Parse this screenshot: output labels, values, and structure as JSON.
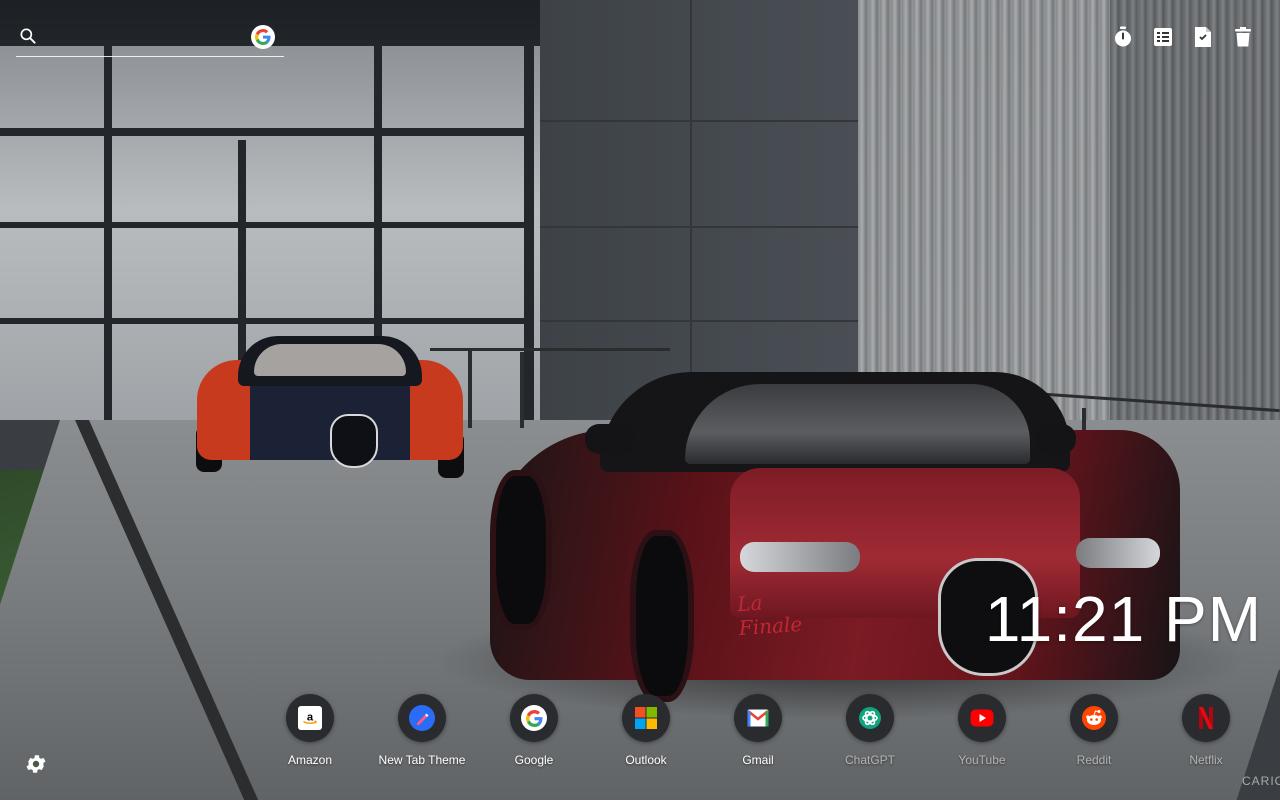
{
  "search": {
    "placeholder": "",
    "engine_icon": "google-g-icon"
  },
  "toolbar": {
    "items": [
      {
        "name": "timer-icon"
      },
      {
        "name": "todo-list-icon"
      },
      {
        "name": "notes-icon"
      },
      {
        "name": "trash-icon"
      }
    ]
  },
  "clock": {
    "time": "11:21 PM"
  },
  "shortcuts": [
    {
      "label": "Amazon",
      "icon": "amazon-icon",
      "color": "#000000"
    },
    {
      "label": "New Tab Theme",
      "icon": "new-tab-theme-icon",
      "color": "#2b6cf6"
    },
    {
      "label": "Google",
      "icon": "google-icon",
      "color": "#4285f4"
    },
    {
      "label": "Outlook",
      "icon": "microsoft-icon",
      "color": "#f25022"
    },
    {
      "label": "Gmail",
      "icon": "gmail-icon",
      "color": "#ea4335"
    },
    {
      "label": "ChatGPT",
      "icon": "chatgpt-icon",
      "color": "#10a37f"
    },
    {
      "label": "YouTube",
      "icon": "youtube-icon",
      "color": "#ff0000"
    },
    {
      "label": "Reddit",
      "icon": "reddit-icon",
      "color": "#ff4500"
    },
    {
      "label": "Netflix",
      "icon": "netflix-icon",
      "color": "#e50914"
    }
  ],
  "car_badge_text": "La Finale",
  "watermark": "CARIO",
  "colors": {
    "dock_circle": "#2a2b2e",
    "text": "#ffffff"
  }
}
